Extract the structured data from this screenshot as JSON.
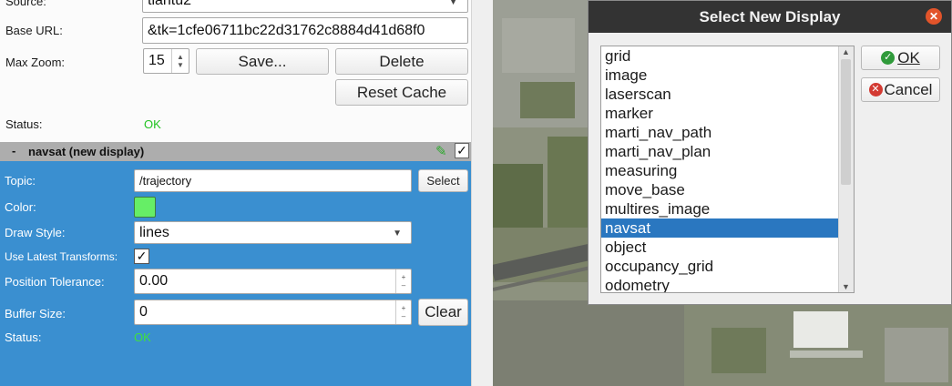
{
  "top_section": {
    "source_label": "Source:",
    "source_value": "tiantu2",
    "base_url_label": "Base URL:",
    "base_url_value": "&tk=1cfe06711bc22d31762c8884d41d68f0",
    "max_zoom_label": "Max Zoom:",
    "max_zoom_value": "15",
    "save_label": "Save...",
    "delete_label": "Delete",
    "reset_cache_label": "Reset Cache",
    "status_label": "Status:",
    "status_value": "OK"
  },
  "navsat": {
    "header": "navsat (new display)",
    "collapse_symbol": "-",
    "topic_label": "Topic:",
    "topic_value": "/trajectory",
    "select_label": "Select",
    "color_label": "Color:",
    "color_value": "#66ee66",
    "draw_style_label": "Draw Style:",
    "draw_style_value": "lines",
    "use_latest_label": "Use Latest Transforms:",
    "position_tolerance_label": "Position Tolerance:",
    "position_tolerance_value": "0.00",
    "buffer_size_label": "Buffer Size:",
    "buffer_size_value": "0",
    "clear_label": "Clear",
    "status_label": "Status:",
    "status_value": "OK"
  },
  "dialog": {
    "title": "Select New Display",
    "ok_label": "OK",
    "cancel_label": "Cancel",
    "items": [
      "grid",
      "image",
      "laserscan",
      "marker",
      "marti_nav_path",
      "marti_nav_plan",
      "measuring",
      "move_base",
      "multires_image",
      "navsat",
      "object",
      "occupancy_grid",
      "odometry"
    ],
    "selected": "navsat"
  },
  "colors": {
    "section_blue": "#3a8fd0",
    "status_green_top": "#22c322",
    "status_green_navsat": "#3fe03f",
    "dialog_title_bg": "#333333",
    "close_orange": "#e2542a",
    "selected_item": "#2a77c0"
  }
}
